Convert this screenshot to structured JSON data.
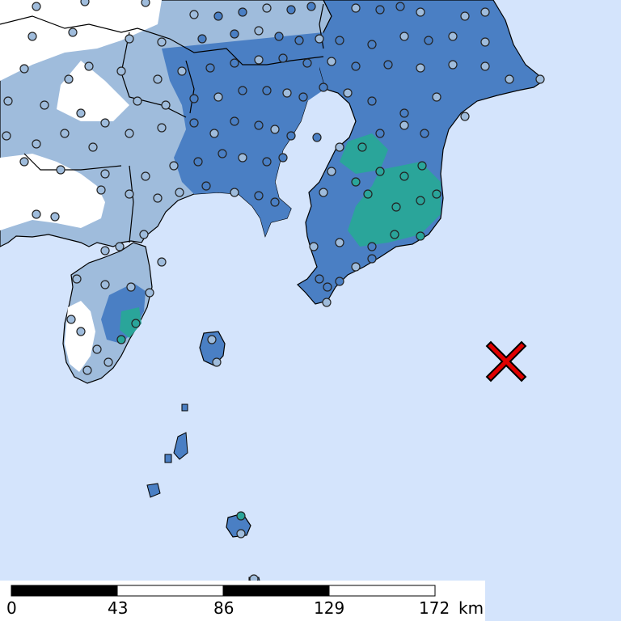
{
  "map": {
    "colors": {
      "sea": "#d4e4fc",
      "land_no_data": "#ffffff",
      "intensity_low": "#9fbcdc",
      "intensity_mid": "#4a7fc4",
      "intensity_high": "#2aa59a",
      "border": "#000000",
      "epicenter": "#e00000"
    },
    "station_colors": [
      "#9fbcdc",
      "#4a7fc4",
      "#2aa59a"
    ],
    "epicenter_icon": "x-cross-icon",
    "scale_bar": {
      "labels": [
        "0",
        "43",
        "86",
        "129",
        "172"
      ],
      "unit": "km"
    }
  }
}
